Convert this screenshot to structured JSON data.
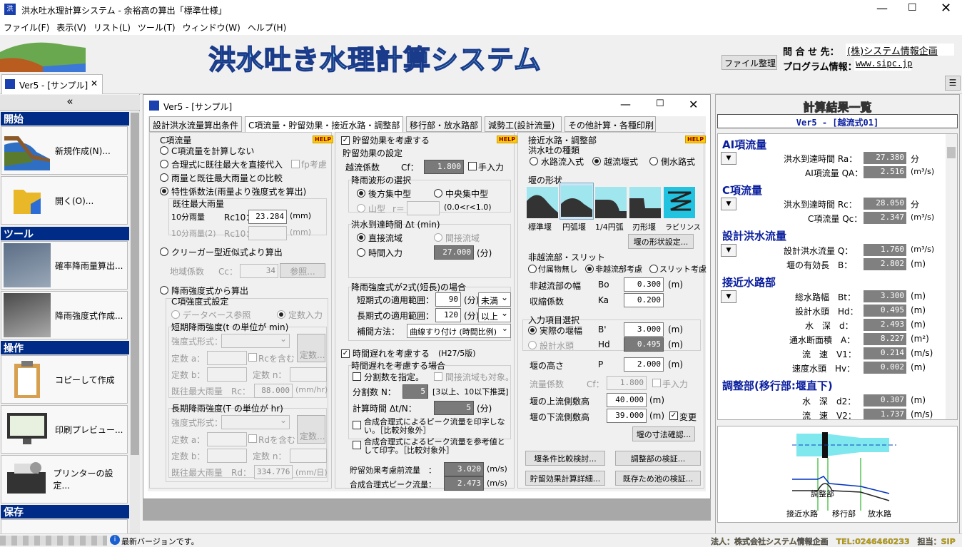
{
  "app": {
    "title": "洪水吐水理計算システム - 余裕高の算出「標準仕様」",
    "banner": "洪水吐き水理計算システム",
    "inquiry_label": "問 合 せ 先：",
    "inquiry_value": "(株)システム情報企画",
    "program_label": "プログラム情報：",
    "program_value": "www.sipc.jp",
    "file_btn": "ファイル整理"
  },
  "menu": [
    "ファイル(F)",
    "表示(V)",
    "リスト(L)",
    "ツール(T)",
    "ウィンドウ(W)",
    "ヘルプ(H)"
  ],
  "doc_tab": "Ver5 - [サンプル]",
  "collapse": "«",
  "nav": {
    "start": "開始",
    "new": "新規作成(N)...",
    "open": "開く(O)...",
    "tools": "ツール",
    "rain": "確率降雨量算出...",
    "intensity": "降雨強度式作成...",
    "ops": "操作",
    "copy": "コピーして作成",
    "preview": "印刷プレビュー...",
    "printer": "プリンターの設定...",
    "save": "保存"
  },
  "win": {
    "title": "Ver5 - [サンプル]"
  },
  "tabs": [
    "設計洪水流量算出条件",
    "C項流量・貯留効果・接近水路・調整部",
    "移行部・放水路部",
    "減勢工(設計流量)",
    "その他計算・各種印刷"
  ],
  "help": "HELP",
  "c": {
    "head": "C項流量",
    "r1": "C項流量を計算しない",
    "r2": "合理式に既往最大を直接代入",
    "fp": "fp考慮",
    "r3": "雨量と既往最大雨量との比較",
    "r4": "特性係数法(雨量より強度式を算出)",
    "max_head": "既往最大雨量",
    "rain10": "10分雨量",
    "rc10": "Rc10：",
    "rain10_v": "23.284",
    "mm": "(mm)",
    "rain10b": "10分雨量(2)",
    "rc10b": "Rc10：",
    "r5": "クリーガー型近似式より算出",
    "region": "地域係数",
    "cc": "Cc：",
    "cc_v": "34",
    "ref": "参照...",
    "r6": "降雨強度式から算出",
    "ci": "C項強度式設定",
    "db": "データベース参照",
    "direct": "定数入力",
    "short_head": "短期降雨強度(t の単位が min)",
    "formula": "強度式形式：",
    "const_btn": "定数...",
    "ka": "定数 a：",
    "kb": "定数 b：",
    "kn": "定数 n：",
    "rc_inc": "Rcを含む",
    "rmax": "既往最大雨量　Rc：",
    "rmax_v": "88.000",
    "mmhr": "(mm/hr)",
    "long_head": "長期降雨強度(T の単位が hr)",
    "rd_inc": "Rdを含む",
    "rdmax": "既往最大雨量　Rd：",
    "rdmax_v": "334.776",
    "mmday": "(mm/日)"
  },
  "s": {
    "store": "貯留効果を考慮する",
    "set": "貯留効果の設定",
    "cf_l": "越流係数",
    "cf": "Cf：",
    "cf_v": "1.800",
    "manual": "手入力",
    "wave": "降雨波形の選択",
    "back": "後方集中型",
    "center": "中央集中型",
    "mount": "山型",
    "r": "r＝",
    "rng": "(0.0<r<1.0)",
    "arrive": "洪水到達時間 Δt (min)",
    "dflow": "直接流域",
    "iflow": "間接流域",
    "tin": "時間入力",
    "t_v": "27.000",
    "min": "(分)",
    "two": "降雨強度式が2式(短長)の場合",
    "sr": "短期式の適用範囲：",
    "sr_v": "90",
    "below": "未満",
    "lr": "長期式の適用範囲：",
    "lr_v": "120",
    "above": "以上",
    "comp": "補間方法：",
    "comp_v": "曲線すり付け (時間比例)",
    "lag": "時間遅れを考慮する",
    "ver": "(H27/5版)",
    "lagc": "時間遅れを考慮する場合",
    "div": "分割数を指定。",
    "indirect": "間接流域も対象。",
    "n": "分割数 N：",
    "n_v": "5",
    "nr": "[3以上、10以下推奨]",
    "dt": "計算時間 Δt/N：",
    "dt_v": "5",
    "print1": "合成合理式によるピーク流量を印字しない。［比較対象外］",
    "print2": "合成合理式によるピーク流量を参考値として印字。［比較対象外］",
    "before": "貯留効果考慮前流量　：",
    "before_v": "3.020",
    "peak": "合成合理式ピーク流量：",
    "peak_v": "2.473",
    "ms": "(m/s)"
  },
  "a": {
    "head": "接近水路・調整部",
    "kind": "洪水吐の種類",
    "k1": "水路流入式",
    "k2": "越流堰式",
    "k3": "側水路式",
    "shape": "堰の形状",
    "sh": [
      "標準堰",
      "円弧堰",
      "1/4円弧",
      "刃形堰",
      "ラビリンス"
    ],
    "shape_btn": "堰の形状設定...",
    "slit": "非越流部・スリット",
    "s1": "付属物無し",
    "s2": "非越流部考慮",
    "s3": "スリット考慮",
    "nw": "非越流部の幅",
    "bo": "Bo",
    "bo_v": "0.300",
    "m": "(m)",
    "ka": "収縮係数",
    "kal": "Ka",
    "ka_v": "0.200",
    "sel": "入力項目選択",
    "e1": "実際の堰幅",
    "b": "B'",
    "b_v": "3.000",
    "e2": "設計水頭",
    "hd": "Hd",
    "hd_v": "0.495",
    "ph": "堰の高さ",
    "p": "P",
    "p_v": "2.000",
    "flow": "流量係数",
    "cf": "Cf：",
    "cf_v": "1.800",
    "manual": "手入力",
    "up": "堰の上流側敷高",
    "up_v": "40.000",
    "dn": "堰の下流側敷高",
    "dn_v": "39.000",
    "change": "変更",
    "dim": "堰の寸法確認...",
    "b1": "堰条件比較検討...",
    "b2": "調整部の検証...",
    "b3": "貯留効果計算詳細...",
    "b4": "既存ため池の検証..."
  },
  "res": {
    "title": "計算結果一覧",
    "sub": "Ver5 - [越流式01]",
    "ai": "AI項流量",
    "t_ra": "洪水到達時間 Ra：",
    "ra_v": "27.380",
    "fun": "分",
    "qa": "AI項流量 QA：",
    "qa_v": "2.516",
    "m3s": "(m³/s)",
    "ci": "C項流量",
    "t_rc": "洪水到達時間 Rc：",
    "rc_v": "28.050",
    "qc": "C項流量 Qc：",
    "qc_v": "2.347",
    "design": "設計洪水流量",
    "q": "設計洪水流量 Q：",
    "q_v": "1.760",
    "be": "堰の有効長　B：",
    "be_v": "2.802",
    "m": "(m)",
    "ap": "接近水路部",
    "bt": "総水路幅　Bt：",
    "bt_v": "3.300",
    "hd": "設計水頭　Hd：",
    "hd_v": "0.495",
    "d": "水　深　d：",
    "d_v": "2.493",
    "area": "通水断面積　A：",
    "area_v": "8.227",
    "m2": "(m²)",
    "v1": "流　速　V1：",
    "v1_v": "0.214",
    "ms": "(m/s)",
    "hv": "速度水頭　Hv：",
    "hv_v": "0.002",
    "adj": "調整部(移行部:堰直下)",
    "d2": "水　深　d2：",
    "d2_v": "0.307",
    "v2": "流　速　V2：",
    "v2_v": "1.737",
    "diag": [
      "調整部",
      "接近水路",
      "移行部",
      "放水路"
    ]
  },
  "status": {
    "msg": "最新バージョンです。",
    "company": "法人：株式会社システム情報企画　TEL:0246460233　担当：SIP"
  }
}
